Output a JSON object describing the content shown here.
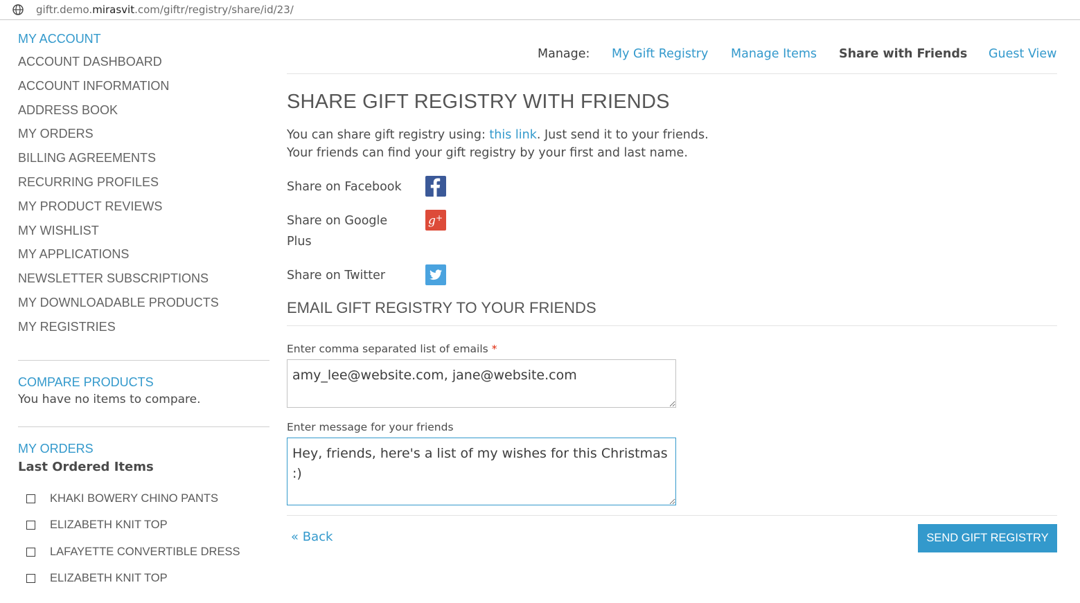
{
  "browser": {
    "url_prefix": "giftr.demo.",
    "url_domain": "mirasvit",
    "url_suffix": ".com/giftr/registry/share/id/23/"
  },
  "sidebar": {
    "account_title": "MY ACCOUNT",
    "items": [
      {
        "label": "ACCOUNT DASHBOARD"
      },
      {
        "label": "ACCOUNT INFORMATION"
      },
      {
        "label": "ADDRESS BOOK"
      },
      {
        "label": "MY ORDERS"
      },
      {
        "label": "BILLING AGREEMENTS"
      },
      {
        "label": "RECURRING PROFILES"
      },
      {
        "label": "MY PRODUCT REVIEWS"
      },
      {
        "label": "MY WISHLIST"
      },
      {
        "label": "MY APPLICATIONS"
      },
      {
        "label": "NEWSLETTER SUBSCRIPTIONS"
      },
      {
        "label": "MY DOWNLOADABLE PRODUCTS"
      },
      {
        "label": "MY REGISTRIES"
      }
    ],
    "compare_title": "COMPARE PRODUCTS",
    "compare_empty": "You have no items to compare.",
    "orders_title": "MY ORDERS",
    "last_ordered_title": "Last Ordered Items",
    "last_ordered_items": [
      {
        "label": "KHAKI BOWERY CHINO PANTS",
        "checked": false
      },
      {
        "label": "ELIZABETH KNIT TOP",
        "checked": false
      },
      {
        "label": "LAFAYETTE CONVERTIBLE DRESS",
        "checked": false
      },
      {
        "label": "ELIZABETH KNIT TOP",
        "checked": false
      }
    ]
  },
  "topnav": {
    "manage_label": "Manage:",
    "links": [
      {
        "label": "My Gift Registry",
        "active": false
      },
      {
        "label": "Manage Items",
        "active": false
      },
      {
        "label": "Share with Friends",
        "active": true
      },
      {
        "label": "Guest View",
        "active": false
      }
    ]
  },
  "main": {
    "title": "SHARE GIFT REGISTRY WITH FRIENDS",
    "desc_before_link": "You can share gift registry using: ",
    "desc_link": "this link",
    "desc_after_link": ". Just send it to your friends.",
    "desc_line2": "Your friends can find your gift registry by your first and last name.",
    "share": {
      "facebook": "Share on Facebook",
      "google": "Share on Google Plus",
      "twitter": "Share on Twitter"
    },
    "email_section_title": "EMAIL GIFT REGISTRY TO YOUR FRIENDS",
    "emails_label": "Enter comma separated list of emails",
    "required_mark": "*",
    "emails_value": "amy_lee@website.com, jane@website.com",
    "message_label": "Enter message for your friends",
    "message_value": "Hey, friends, here's a list of my wishes for this Christmas :)",
    "back_label": "« Back",
    "send_label": "SEND GIFT REGISTRY"
  },
  "colors": {
    "accent": "#3399cc",
    "facebook": "#3b5998",
    "google": "#dd4b39",
    "twitter": "#4aa3df",
    "required": "#df280a"
  }
}
